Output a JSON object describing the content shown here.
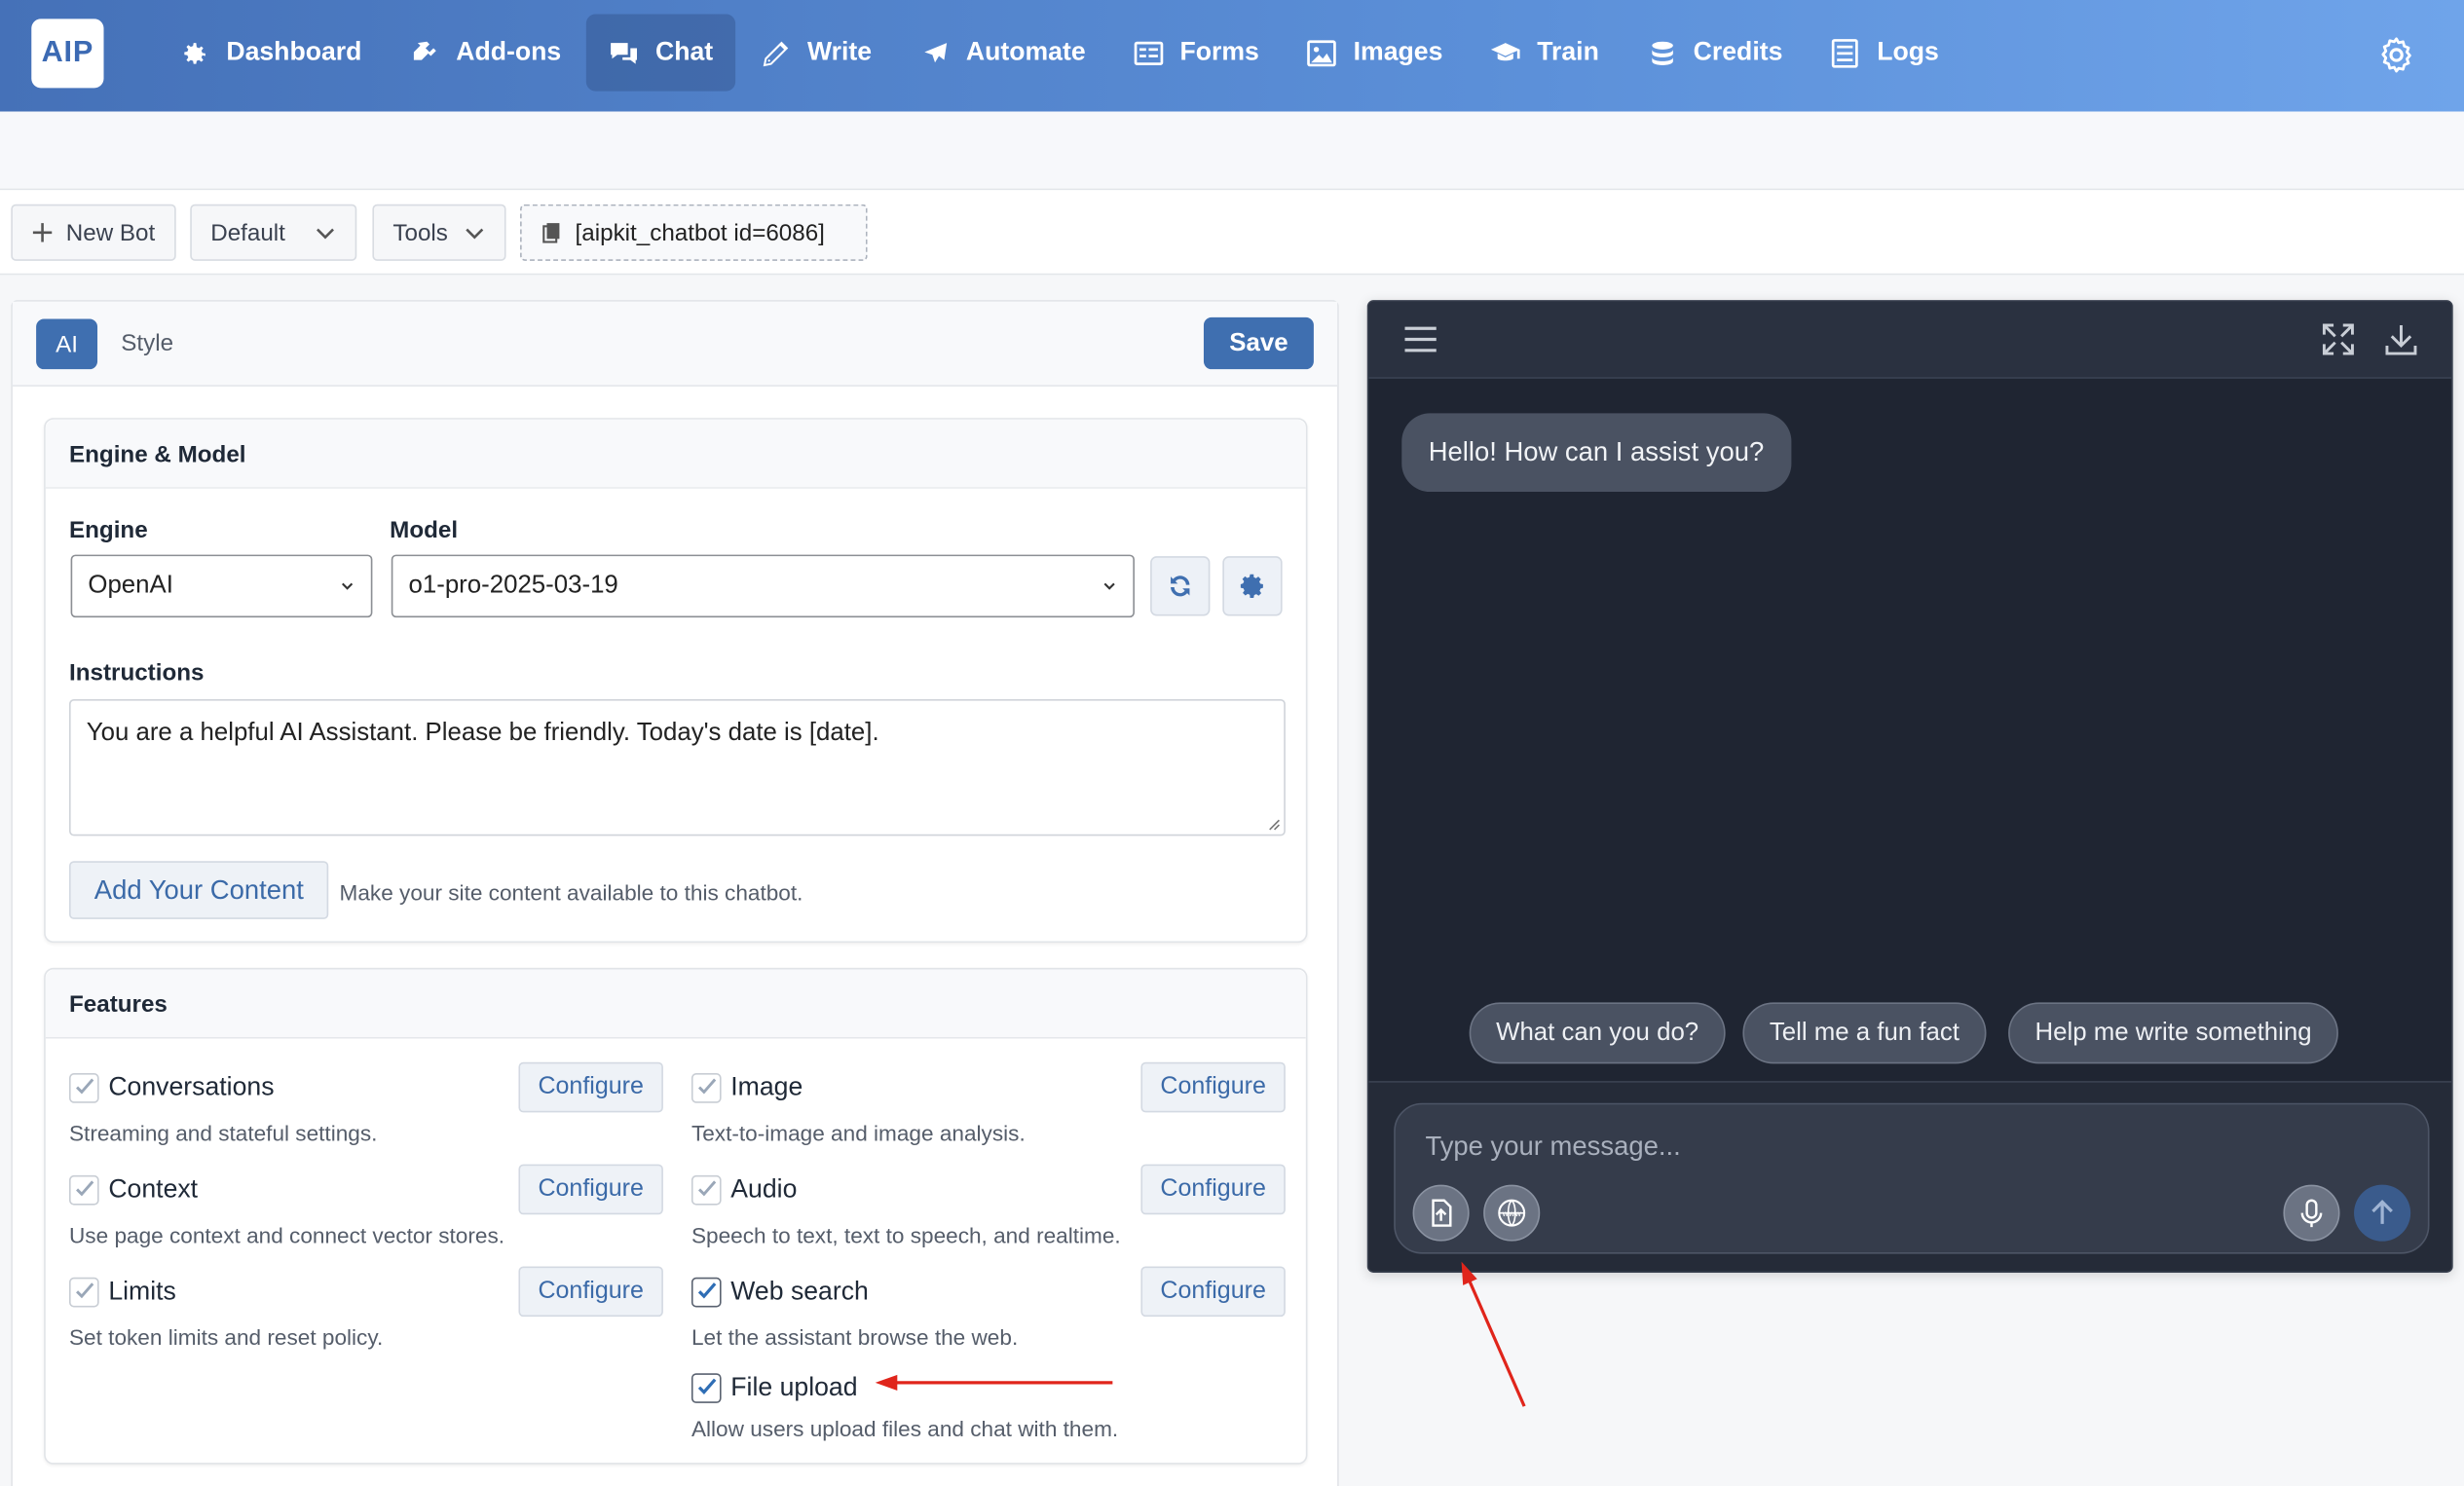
{
  "app": {
    "logo_text": "AIP"
  },
  "nav": [
    {
      "label": "Dashboard",
      "icon": "gear-icon"
    },
    {
      "label": "Add-ons",
      "icon": "plug-icon"
    },
    {
      "label": "Chat",
      "icon": "chat-icon",
      "active": true
    },
    {
      "label": "Write",
      "icon": "pencil-icon"
    },
    {
      "label": "Automate",
      "icon": "plane-icon"
    },
    {
      "label": "Forms",
      "icon": "form-icon"
    },
    {
      "label": "Images",
      "icon": "image-icon"
    },
    {
      "label": "Train",
      "icon": "graduation-icon"
    },
    {
      "label": "Credits",
      "icon": "coins-icon"
    },
    {
      "label": "Logs",
      "icon": "list-icon"
    }
  ],
  "toolbar": {
    "new_bot": "New Bot",
    "default": "Default",
    "tools": "Tools",
    "shortcode": "[aipkit_chatbot id=6086]"
  },
  "panel": {
    "tab_ai": "AI",
    "tab_style": "Style",
    "save": "Save"
  },
  "engine_model": {
    "title": "Engine & Model",
    "engine_label": "Engine",
    "engine_value": "OpenAI",
    "model_label": "Model",
    "model_value": "o1-pro-2025-03-19",
    "instructions_label": "Instructions",
    "instructions_value": "You are a helpful AI Assistant. Please be friendly. Today's date is [date].",
    "add_content": "Add Your Content",
    "add_content_hint": "Make your site content available to this chatbot."
  },
  "features": {
    "title": "Features",
    "configure_label": "Configure",
    "items": [
      {
        "name": "Conversations",
        "desc": "Streaming and stateful settings.",
        "checked": true
      },
      {
        "name": "Image",
        "desc": "Text-to-image and image analysis.",
        "checked": true
      },
      {
        "name": "Context",
        "desc": "Use page context and connect vector stores.",
        "checked": true
      },
      {
        "name": "Audio",
        "desc": "Speech to text, text to speech, and realtime.",
        "checked": true
      },
      {
        "name": "Limits",
        "desc": "Set token limits and reset policy.",
        "checked": true
      },
      {
        "name": "Web search",
        "desc": "Let the assistant browse the web.",
        "checked": true
      },
      {
        "name": "File upload",
        "desc": "Allow users upload files and chat with them.",
        "checked": true
      }
    ]
  },
  "chat": {
    "greeting": "Hello! How can I assist you?",
    "suggestions": [
      "What can you do?",
      "Tell me a fun fact",
      "Help me write something"
    ],
    "placeholder": "Type your message..."
  },
  "colors": {
    "brand": "#3f6fb0",
    "annotation": "#e0251b",
    "chat_bg": "#1f2532"
  }
}
